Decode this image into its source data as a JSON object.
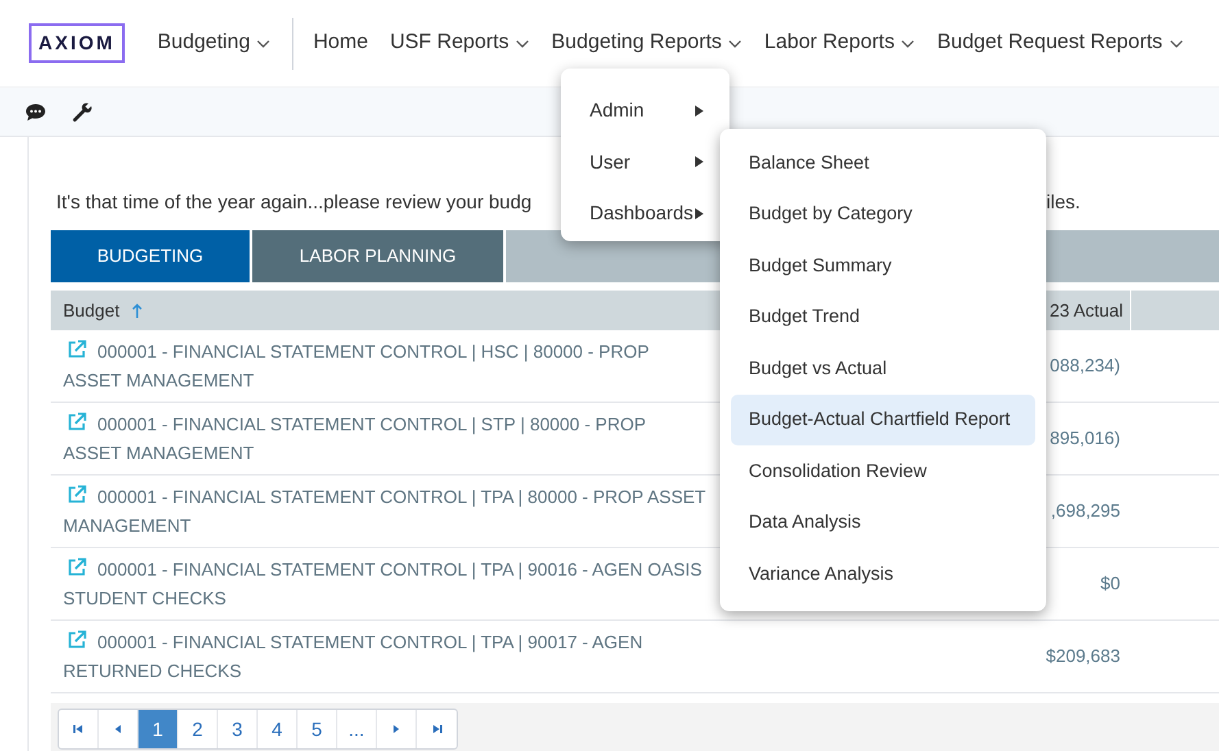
{
  "brand": {
    "logo": "AXIOM"
  },
  "nav": [
    {
      "label": "Budgeting",
      "has_menu": true
    },
    {
      "label": "Home",
      "has_menu": false
    },
    {
      "label": "USF Reports",
      "has_menu": true
    },
    {
      "label": "Budgeting Reports",
      "has_menu": true
    },
    {
      "label": "Labor Reports",
      "has_menu": true
    },
    {
      "label": "Budget Request Reports",
      "has_menu": true
    }
  ],
  "message_parts": [
    "It's that time of the year again...please review your budg",
    "iles."
  ],
  "tabs": [
    {
      "label": "BUDGETING",
      "selected": true
    },
    {
      "label": "LABOR PLANNING",
      "selected": false
    }
  ],
  "table": {
    "columns": [
      {
        "label": "Budget",
        "sorted": true
      },
      {
        "label": "23 Actual",
        "sorted": false
      }
    ],
    "rows": [
      {
        "budget": "000001 - FINANCIAL STATEMENT CONTROL | HSC | 80000 - PROP ASSET MANAGEMENT",
        "amount": "088,234)"
      },
      {
        "budget": "000001 - FINANCIAL STATEMENT CONTROL | STP | 80000 - PROP ASSET MANAGEMENT",
        "amount": "895,016)"
      },
      {
        "budget": "000001 - FINANCIAL STATEMENT CONTROL | TPA | 80000 - PROP ASSET MANAGEMENT",
        "amount": ",698,295"
      },
      {
        "budget": "000001 - FINANCIAL STATEMENT CONTROL | TPA | 90016 - AGEN OASIS STUDENT CHECKS",
        "amount": "$0"
      },
      {
        "budget": "000001 - FINANCIAL STATEMENT CONTROL | TPA | 90017 - AGEN RETURNED CHECKS",
        "amount": "$209,683"
      }
    ]
  },
  "pagination": {
    "pages": [
      {
        "label": "1",
        "selected": true
      },
      {
        "label": "2",
        "selected": false
      },
      {
        "label": "3",
        "selected": false
      },
      {
        "label": "4",
        "selected": false
      },
      {
        "label": "5",
        "selected": false
      },
      {
        "label": "...",
        "selected": false
      }
    ]
  },
  "menu": {
    "items": [
      {
        "label": "Admin",
        "has_submenu": true
      },
      {
        "label": "User",
        "has_submenu": true
      },
      {
        "label": "Dashboards",
        "has_submenu": true
      }
    ]
  },
  "submenu": {
    "items": [
      {
        "label": "Balance Sheet",
        "selected": false
      },
      {
        "label": "Budget by Category",
        "selected": false
      },
      {
        "label": "Budget Summary",
        "selected": false
      },
      {
        "label": "Budget Trend",
        "selected": false
      },
      {
        "label": "Budget vs Actual",
        "selected": false
      },
      {
        "label": "Budget-Actual Chartfield Report",
        "selected": true
      },
      {
        "label": "Consolidation Review",
        "selected": false
      },
      {
        "label": "Data Analysis",
        "selected": false
      },
      {
        "label": "Variance Analysis",
        "selected": false
      }
    ]
  }
}
